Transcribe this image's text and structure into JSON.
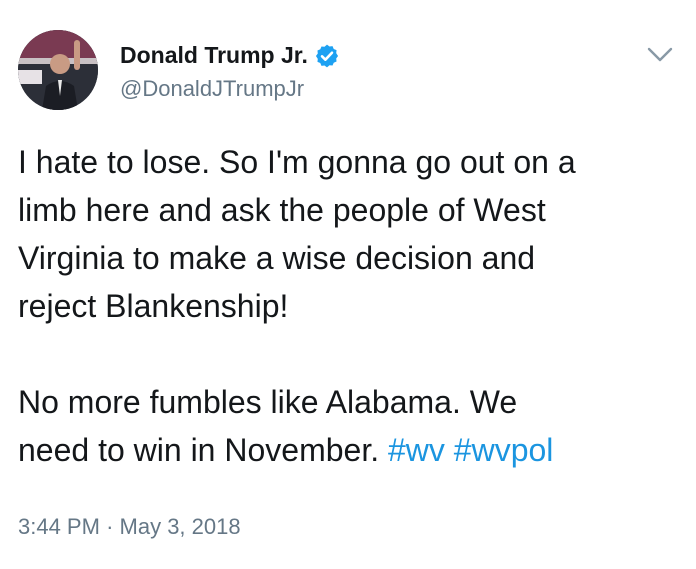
{
  "tweet": {
    "author": {
      "display_name": "Donald Trump Jr.",
      "handle": "@DonaldJTrumpJr",
      "verified": true,
      "avatar_icon": "profile-photo"
    },
    "body": {
      "para1": {
        "line1": "I hate to lose. So I'm gonna go out on a",
        "line2": "limb here and ask the people of West",
        "line3": "Virginia to make a wise decision and",
        "line4": "reject Blankenship!"
      },
      "para2": {
        "line1": "No more fumbles like Alabama. We",
        "line2_text": "need to win in November.",
        "hashtags": [
          "#wv",
          "#wvpol"
        ]
      }
    },
    "timestamp": {
      "time": "3:44 PM",
      "separator": "·",
      "date": "May 3, 2018"
    },
    "menu_icon": "chevron-down-icon"
  },
  "colors": {
    "text": "#14171a",
    "secondary": "#657786",
    "link": "#1b95e0",
    "verified_badge": "#1da1f2"
  }
}
